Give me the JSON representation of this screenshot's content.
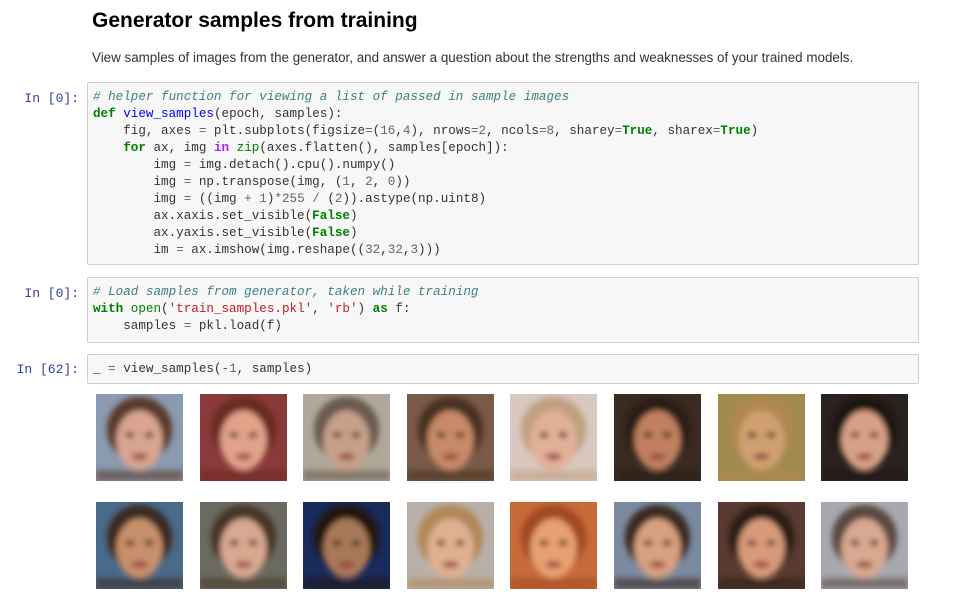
{
  "markdown": {
    "title": "Generator samples from training",
    "description": "View samples of images from the generator, and answer a question about the strengths and weaknesses of your trained models."
  },
  "cells": [
    {
      "prompt": "In [0]:",
      "lines": [
        [
          {
            "t": "c",
            "v": "# helper function for viewing a list of passed in sample images"
          }
        ],
        [
          {
            "t": "k",
            "v": "def"
          },
          {
            "t": "p",
            "v": " "
          },
          {
            "t": "f",
            "v": "view_samples"
          },
          {
            "t": "p",
            "v": "(epoch, samples):"
          }
        ],
        [
          {
            "t": "p",
            "v": "    fig, axes "
          },
          {
            "t": "o",
            "v": "="
          },
          {
            "t": "p",
            "v": " plt.subplots(figsize"
          },
          {
            "t": "o",
            "v": "="
          },
          {
            "t": "p",
            "v": "("
          },
          {
            "t": "n",
            "v": "16"
          },
          {
            "t": "p",
            "v": ","
          },
          {
            "t": "n",
            "v": "4"
          },
          {
            "t": "p",
            "v": "), nrows"
          },
          {
            "t": "o",
            "v": "="
          },
          {
            "t": "n",
            "v": "2"
          },
          {
            "t": "p",
            "v": ", ncols"
          },
          {
            "t": "o",
            "v": "="
          },
          {
            "t": "n",
            "v": "8"
          },
          {
            "t": "p",
            "v": ", sharey"
          },
          {
            "t": "o",
            "v": "="
          },
          {
            "t": "k",
            "v": "True"
          },
          {
            "t": "p",
            "v": ", sharex"
          },
          {
            "t": "o",
            "v": "="
          },
          {
            "t": "k",
            "v": "True"
          },
          {
            "t": "p",
            "v": ")"
          }
        ],
        [
          {
            "t": "p",
            "v": "    "
          },
          {
            "t": "k",
            "v": "for"
          },
          {
            "t": "p",
            "v": " ax, img "
          },
          {
            "t": "w",
            "v": "in"
          },
          {
            "t": "p",
            "v": " "
          },
          {
            "t": "b",
            "v": "zip"
          },
          {
            "t": "p",
            "v": "(axes.flatten(), samples[epoch]):"
          }
        ],
        [
          {
            "t": "p",
            "v": "        img "
          },
          {
            "t": "o",
            "v": "="
          },
          {
            "t": "p",
            "v": " img.detach().cpu().numpy()"
          }
        ],
        [
          {
            "t": "p",
            "v": "        img "
          },
          {
            "t": "o",
            "v": "="
          },
          {
            "t": "p",
            "v": " np.transpose(img, ("
          },
          {
            "t": "n",
            "v": "1"
          },
          {
            "t": "p",
            "v": ", "
          },
          {
            "t": "n",
            "v": "2"
          },
          {
            "t": "p",
            "v": ", "
          },
          {
            "t": "n",
            "v": "0"
          },
          {
            "t": "p",
            "v": "))"
          }
        ],
        [
          {
            "t": "p",
            "v": "        img "
          },
          {
            "t": "o",
            "v": "="
          },
          {
            "t": "p",
            "v": " ((img "
          },
          {
            "t": "o",
            "v": "+"
          },
          {
            "t": "p",
            "v": " "
          },
          {
            "t": "n",
            "v": "1"
          },
          {
            "t": "p",
            "v": ")"
          },
          {
            "t": "o",
            "v": "*"
          },
          {
            "t": "n",
            "v": "255"
          },
          {
            "t": "p",
            "v": " "
          },
          {
            "t": "o",
            "v": "/"
          },
          {
            "t": "p",
            "v": " ("
          },
          {
            "t": "n",
            "v": "2"
          },
          {
            "t": "p",
            "v": ")).astype(np.uint8)"
          }
        ],
        [
          {
            "t": "p",
            "v": "        ax.xaxis.set_visible("
          },
          {
            "t": "k",
            "v": "False"
          },
          {
            "t": "p",
            "v": ")"
          }
        ],
        [
          {
            "t": "p",
            "v": "        ax.yaxis.set_visible("
          },
          {
            "t": "k",
            "v": "False"
          },
          {
            "t": "p",
            "v": ")"
          }
        ],
        [
          {
            "t": "p",
            "v": "        im "
          },
          {
            "t": "o",
            "v": "="
          },
          {
            "t": "p",
            "v": " ax.imshow(img.reshape(("
          },
          {
            "t": "n",
            "v": "32"
          },
          {
            "t": "p",
            "v": ","
          },
          {
            "t": "n",
            "v": "32"
          },
          {
            "t": "p",
            "v": ","
          },
          {
            "t": "n",
            "v": "3"
          },
          {
            "t": "p",
            "v": ")))"
          }
        ]
      ]
    },
    {
      "prompt": "In [0]:",
      "lines": [
        [
          {
            "t": "c",
            "v": "# Load samples from generator, taken while training"
          }
        ],
        [
          {
            "t": "k",
            "v": "with"
          },
          {
            "t": "p",
            "v": " "
          },
          {
            "t": "b",
            "v": "open"
          },
          {
            "t": "p",
            "v": "("
          },
          {
            "t": "s",
            "v": "'train_samples.pkl'"
          },
          {
            "t": "p",
            "v": ", "
          },
          {
            "t": "s",
            "v": "'rb'"
          },
          {
            "t": "p",
            "v": ") "
          },
          {
            "t": "k",
            "v": "as"
          },
          {
            "t": "p",
            "v": " f:"
          }
        ],
        [
          {
            "t": "p",
            "v": "    samples "
          },
          {
            "t": "o",
            "v": "="
          },
          {
            "t": "p",
            "v": " pkl.load(f)"
          }
        ]
      ]
    },
    {
      "prompt": "In [62]:",
      "lines": [
        [
          {
            "t": "p",
            "v": "_ "
          },
          {
            "t": "o",
            "v": "="
          },
          {
            "t": "p",
            "v": " view_samples("
          },
          {
            "t": "o",
            "v": "-"
          },
          {
            "t": "n",
            "v": "1"
          },
          {
            "t": "p",
            "v": ", samples)"
          }
        ]
      ]
    }
  ],
  "output": {
    "rows": 2,
    "cols": 8,
    "faces": [
      {
        "bg": "#8a9ab0",
        "skin": "#d9a590",
        "hair": "#5a3a2a"
      },
      {
        "bg": "#8a3a3a",
        "skin": "#e2a28a",
        "hair": "#6a2a20"
      },
      {
        "bg": "#b0a898",
        "skin": "#c8a088",
        "hair": "#6a5a50"
      },
      {
        "bg": "#7a5a48",
        "skin": "#c88a68",
        "hair": "#4a3020"
      },
      {
        "bg": "#d8c8c0",
        "skin": "#e2b098",
        "hair": "#c0a080"
      },
      {
        "bg": "#3a2a22",
        "skin": "#c08060",
        "hair": "#2a1a12"
      },
      {
        "bg": "#a08a50",
        "skin": "#d0a070",
        "hair": "#b08850"
      },
      {
        "bg": "#2a2220",
        "skin": "#d8a088",
        "hair": "#1a1210"
      },
      {
        "bg": "#4a6a8a",
        "skin": "#c8906a",
        "hair": "#3a2a20"
      },
      {
        "bg": "#6a6a60",
        "skin": "#d8a890",
        "hair": "#4a3628"
      },
      {
        "bg": "#1a2a5a",
        "skin": "#a87858",
        "hair": "#201810"
      },
      {
        "bg": "#b8b0a8",
        "skin": "#e0b090",
        "hair": "#b08858"
      },
      {
        "bg": "#c86a3a",
        "skin": "#e8a070",
        "hair": "#a04a20"
      },
      {
        "bg": "#7a8aa0",
        "skin": "#d8a080",
        "hair": "#3a2a20"
      },
      {
        "bg": "#5a3a30",
        "skin": "#d89a7a",
        "hair": "#2a1a12"
      },
      {
        "bg": "#a8a8b0",
        "skin": "#d8a890",
        "hair": "#5a4a40"
      }
    ]
  }
}
